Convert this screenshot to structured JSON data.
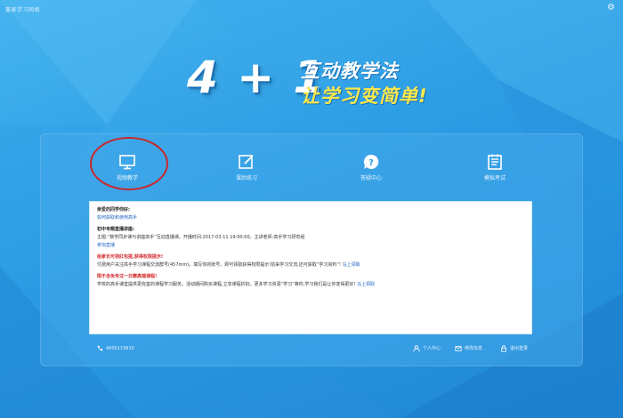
{
  "app": {
    "title": "赢家学习网络"
  },
  "slogan": {
    "big": "4 + 1",
    "line1": "互动教学法",
    "line2": "让学习变简单!"
  },
  "tiles": [
    {
      "label": "视频教学",
      "icon": "monitor-icon"
    },
    {
      "label": "课后练习",
      "icon": "edit-icon"
    },
    {
      "label": "答疑中心",
      "icon": "question-icon"
    },
    {
      "label": "模拟考试",
      "icon": "exam-icon"
    }
  ],
  "notice": {
    "greeting": "亲爱的同学你好:",
    "how_to_title": "如何获取和使用高手",
    "section_title": "初中专题直播讲座:",
    "live_line": "主题:“数学同步课与讲座高手”互动直播课。开播时间:2017-03-11 19:00:00。主讲老师:高手学习研究组",
    "join_link": "参加直播",
    "promo1_title": "给家长可领红包提,获得权限提示!",
    "promo1_body": "付费用户关注高手学习课程交流群号(457mm)。填写你的账号。即可领取获得权限提示!前来学习交流,还可获取“学习资料”!",
    "promo1_link": "马上领取",
    "promo2_title": "限不含免专注一日赠高端课程!",
    "promo2_body": "学校的高手课堂提供更完善的课程学习服务。活动期间购买课程,立享课程折扣。更多学习资源“学习”等你,学习我们是让你变得更好!",
    "promo2_link": "马上领取"
  },
  "footer": {
    "phone": "4006119910",
    "center": "个人中心",
    "account": "修改信息",
    "logout": "退出登录"
  }
}
